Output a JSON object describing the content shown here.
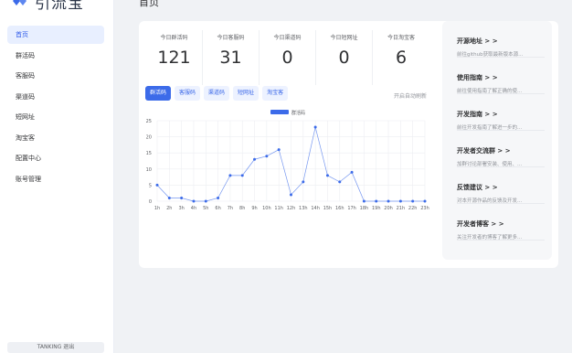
{
  "app": {
    "name": "引流宝"
  },
  "sidebar": {
    "items": [
      {
        "label": "首页"
      },
      {
        "label": "群活码"
      },
      {
        "label": "客服码"
      },
      {
        "label": "渠道码"
      },
      {
        "label": "短网址"
      },
      {
        "label": "淘宝客"
      },
      {
        "label": "配置中心"
      },
      {
        "label": "账号管理"
      }
    ],
    "user": "TANKING  退出"
  },
  "page": {
    "title": "首页"
  },
  "stats": [
    {
      "label": "今日群活码",
      "value": "121"
    },
    {
      "label": "今日客服码",
      "value": "31"
    },
    {
      "label": "今日渠道码",
      "value": "0"
    },
    {
      "label": "今日短网址",
      "value": "0"
    },
    {
      "label": "今日淘宝客",
      "value": "6"
    }
  ],
  "tabs": [
    {
      "label": "群活码"
    },
    {
      "label": "客服码"
    },
    {
      "label": "渠道码"
    },
    {
      "label": "短网址"
    },
    {
      "label": "淘宝客"
    }
  ],
  "auto_refresh": "开启自动刷新",
  "chart_data": {
    "type": "line",
    "categories": [
      "1h",
      "2h",
      "3h",
      "4h",
      "5h",
      "6h",
      "7h",
      "8h",
      "9h",
      "10h",
      "11h",
      "12h",
      "13h",
      "14h",
      "15h",
      "16h",
      "17h",
      "18h",
      "19h",
      "20h",
      "21h",
      "22h",
      "23h"
    ],
    "series": [
      {
        "name": "群活码",
        "values": [
          5,
          1,
          1,
          0,
          0,
          1,
          8,
          8,
          13,
          14,
          16,
          2,
          6,
          23,
          8,
          6,
          9,
          0,
          0,
          0,
          0,
          0,
          0
        ],
        "color": "#3c6be9"
      }
    ],
    "yticks": [
      0,
      5,
      10,
      15,
      20,
      25
    ],
    "ylim": [
      0,
      25
    ],
    "grid": true,
    "legend": "top-center"
  },
  "links": [
    {
      "title": "开源地址 > >",
      "desc": "前往github获取最新版本源..."
    },
    {
      "title": "使用指南 > >",
      "desc": "前往使用指南了解正确的使..."
    },
    {
      "title": "开发指南 > >",
      "desc": "前往开发指南了解进一步的..."
    },
    {
      "title": "开发者交流群 > >",
      "desc": "加群讨论部署安装、使用、..."
    },
    {
      "title": "反馈建议 > >",
      "desc": "对本开源作品的反馈及开发..."
    },
    {
      "title": "开发者博客 > >",
      "desc": "关注开发者的博客了解更多..."
    }
  ]
}
